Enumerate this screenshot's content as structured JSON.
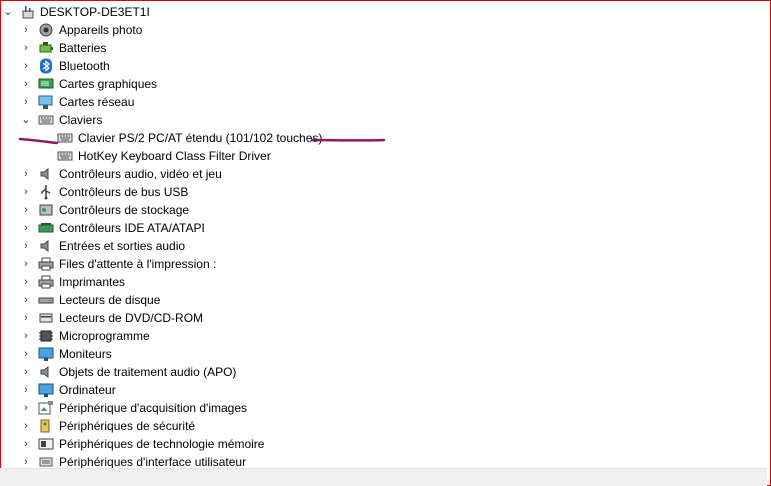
{
  "root": {
    "label": "DESKTOP-DE3ET1I",
    "icon": "computer-icon",
    "expanded": true
  },
  "categories": [
    {
      "label": "Appareils photo",
      "icon": "camera-icon"
    },
    {
      "label": "Batteries",
      "icon": "battery-icon"
    },
    {
      "label": "Bluetooth",
      "icon": "bluetooth-icon"
    },
    {
      "label": "Cartes graphiques",
      "icon": "display-adapter-icon"
    },
    {
      "label": "Cartes réseau",
      "icon": "network-adapter-icon"
    },
    {
      "label": "Claviers",
      "icon": "keyboard-icon",
      "expanded": true,
      "children": [
        {
          "label": "Clavier PS/2 PC/AT étendu (101/102 touches)",
          "icon": "keyboard-icon"
        },
        {
          "label": "HotKey Keyboard Class Filter Driver",
          "icon": "keyboard-icon"
        }
      ]
    },
    {
      "label": "Contrôleurs audio, vidéo et jeu",
      "icon": "speaker-icon"
    },
    {
      "label": "Contrôleurs de bus USB",
      "icon": "usb-icon"
    },
    {
      "label": "Contrôleurs de stockage",
      "icon": "storage-controller-icon"
    },
    {
      "label": "Contrôleurs IDE ATA/ATAPI",
      "icon": "ide-controller-icon"
    },
    {
      "label": "Entrées et sorties audio",
      "icon": "speaker-icon"
    },
    {
      "label": "Files d'attente à l'impression :",
      "icon": "printer-icon"
    },
    {
      "label": "Imprimantes",
      "icon": "printer-icon"
    },
    {
      "label": "Lecteurs de disque",
      "icon": "disk-drive-icon"
    },
    {
      "label": "Lecteurs de DVD/CD-ROM",
      "icon": "dvd-drive-icon"
    },
    {
      "label": "Microprogramme",
      "icon": "firmware-icon"
    },
    {
      "label": "Moniteurs",
      "icon": "monitor-icon"
    },
    {
      "label": "Objets de traitement audio (APO)",
      "icon": "speaker-icon"
    },
    {
      "label": "Ordinateur",
      "icon": "monitor-icon"
    },
    {
      "label": "Périphérique d'acquisition d'images",
      "icon": "imaging-device-icon"
    },
    {
      "label": "Périphériques de sécurité",
      "icon": "security-device-icon"
    },
    {
      "label": "Périphériques de technologie mémoire",
      "icon": "memory-technology-icon"
    },
    {
      "label": "Périphériques d'interface utilisateur",
      "icon": "hid-icon"
    }
  ],
  "colors": {
    "frame": "#e00000",
    "annotation": "#8b1a6b",
    "selection_accent": "#0078d7"
  }
}
